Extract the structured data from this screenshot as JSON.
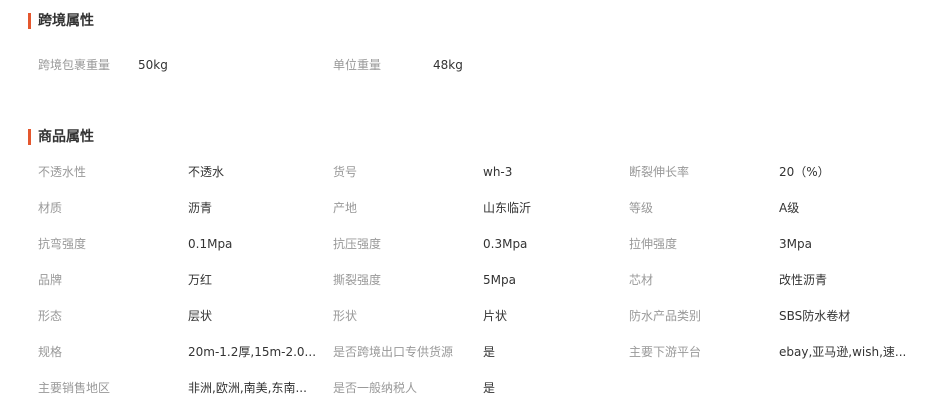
{
  "cross_border": {
    "title": "跨境属性",
    "items": [
      {
        "label": "跨境包裹重量",
        "value": "50kg"
      },
      {
        "label": "单位重量",
        "value": "48kg"
      }
    ]
  },
  "product": {
    "title": "商品属性",
    "rows": [
      [
        {
          "label": "不透水性",
          "value": "不透水"
        },
        {
          "label": "货号",
          "value": "wh-3"
        },
        {
          "label": "断裂伸长率",
          "value": "20（%）"
        }
      ],
      [
        {
          "label": "材质",
          "value": "沥青"
        },
        {
          "label": "产地",
          "value": "山东临沂"
        },
        {
          "label": "等级",
          "value": "A级"
        }
      ],
      [
        {
          "label": "抗弯强度",
          "value": "0.1Mpa"
        },
        {
          "label": "抗压强度",
          "value": "0.3Mpa"
        },
        {
          "label": "拉伸强度",
          "value": "3Mpa"
        }
      ],
      [
        {
          "label": "品牌",
          "value": "万红"
        },
        {
          "label": "撕裂强度",
          "value": "5Mpa"
        },
        {
          "label": "芯材",
          "value": "改性沥青"
        }
      ],
      [
        {
          "label": "形态",
          "value": "层状"
        },
        {
          "label": "形状",
          "value": "片状"
        },
        {
          "label": "防水产品类别",
          "value": "SBS防水卷材"
        }
      ],
      [
        {
          "label": "规格",
          "value": "20m-1.2厚,15m-2.0..."
        },
        {
          "label": "是否跨境出口专供货源",
          "value": "是"
        },
        {
          "label": "主要下游平台",
          "value": "ebay,亚马逊,wish,速..."
        }
      ],
      [
        {
          "label": "主要销售地区",
          "value": "非洲,欧洲,南美,东南..."
        },
        {
          "label": "是否一般纳税人",
          "value": "是"
        }
      ]
    ]
  },
  "colors": {
    "accent_bar": "#e4572e",
    "label_text": "#999999",
    "value_text": "#333333"
  }
}
